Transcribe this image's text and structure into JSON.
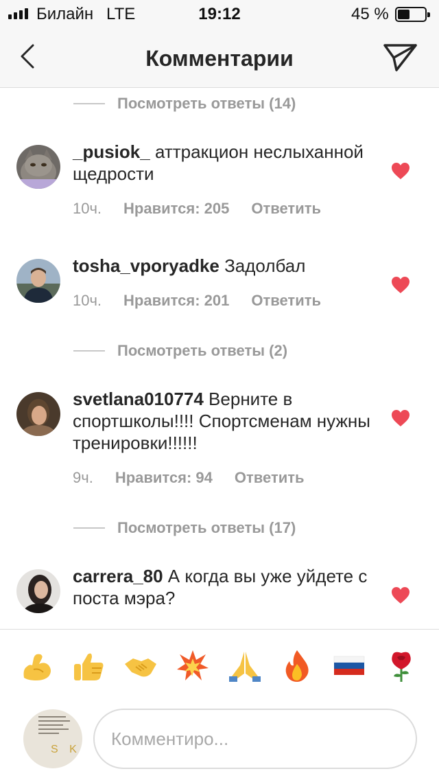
{
  "status_bar": {
    "carrier": "Билайн",
    "network": "LTE",
    "time": "19:12",
    "battery_percent_label": "45 %",
    "battery_level": 0.45
  },
  "nav": {
    "title": "Комментарии",
    "back_icon": "chevron-left-icon",
    "send_icon": "paper-plane-icon"
  },
  "comments": {
    "view_replies": [
      {
        "label": "Посмотреть ответы (14)"
      },
      {
        "label": "Посмотреть ответы (2)"
      },
      {
        "label": "Посмотреть ответы (17)"
      }
    ],
    "items": [
      {
        "username": "_pusiok_",
        "text": " аттракцион неслыханной щедрости",
        "time": "10ч.",
        "likes": "Нравится: 205",
        "reply": "Ответить",
        "liked": true
      },
      {
        "username": "tosha_vporyadke",
        "text": " Задолбал",
        "time": "10ч.",
        "likes": "Нравится: 201",
        "reply": "Ответить",
        "liked": true
      },
      {
        "username": "svetlana010774",
        "text": " Верните в спортшколы!!!! Спортсменам нужны тренировки!!!!!!",
        "time": "9ч.",
        "likes": "Нравится: 94",
        "reply": "Ответить",
        "liked": true
      },
      {
        "username": "carrera_80",
        "text": " А когда вы уже уйдете с поста мэра?",
        "liked": true
      }
    ]
  },
  "emoji_bar": {
    "emojis": [
      "flexed-biceps",
      "thumbs-up",
      "handshake",
      "collision",
      "folded-hands",
      "fire",
      "russia-flag",
      "rose"
    ]
  },
  "composer": {
    "placeholder": "Комментиро..."
  },
  "colors": {
    "like_red": "#ed4956",
    "secondary_text": "#999999",
    "primary_text": "#262626"
  }
}
